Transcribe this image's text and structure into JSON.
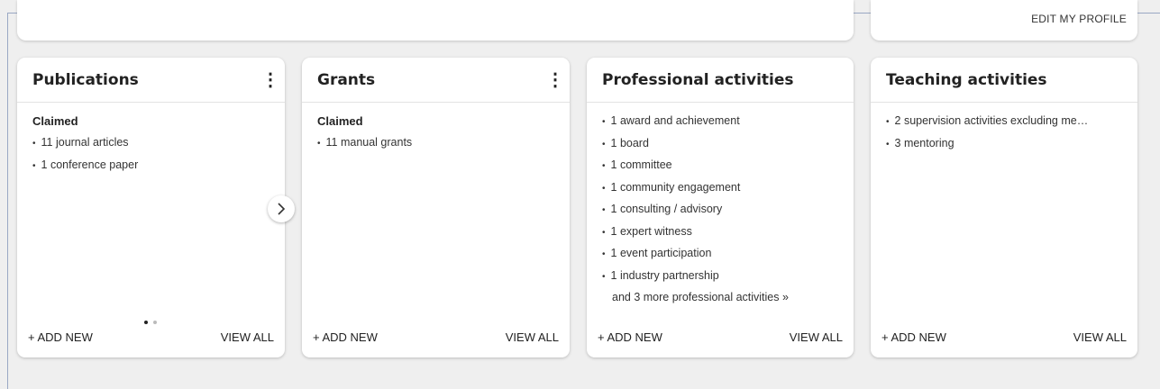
{
  "header": {
    "edit_profile": "EDIT MY PROFILE"
  },
  "cards": [
    {
      "title": "Publications",
      "section": "Claimed",
      "items": [
        "11 journal articles",
        "1 conference paper"
      ],
      "add_new": "+ ADD NEW",
      "view_all": "VIEW ALL",
      "carousel": {
        "pages": 2,
        "active": 1
      }
    },
    {
      "title": "Grants",
      "section": "Claimed",
      "items": [
        "11 manual grants"
      ],
      "add_new": "+ ADD NEW",
      "view_all": "VIEW ALL"
    },
    {
      "title": "Professional activities",
      "items": [
        "1 award and achievement",
        "1 board",
        "1 committee",
        "1 community engagement",
        "1 consulting / advisory",
        "1 expert witness",
        "1 event participation",
        "1 industry partnership"
      ],
      "more": "and 3 more professional activities »",
      "add_new": "+ ADD NEW",
      "view_all": "VIEW ALL"
    },
    {
      "title": "Teaching activities",
      "items": [
        "2 supervision activities excluding me…",
        "3 mentoring"
      ],
      "add_new": "+ ADD NEW",
      "view_all": "VIEW ALL"
    }
  ],
  "icons": {
    "kebab": "vertical-ellipsis-icon",
    "next": "chevron-right-icon"
  }
}
